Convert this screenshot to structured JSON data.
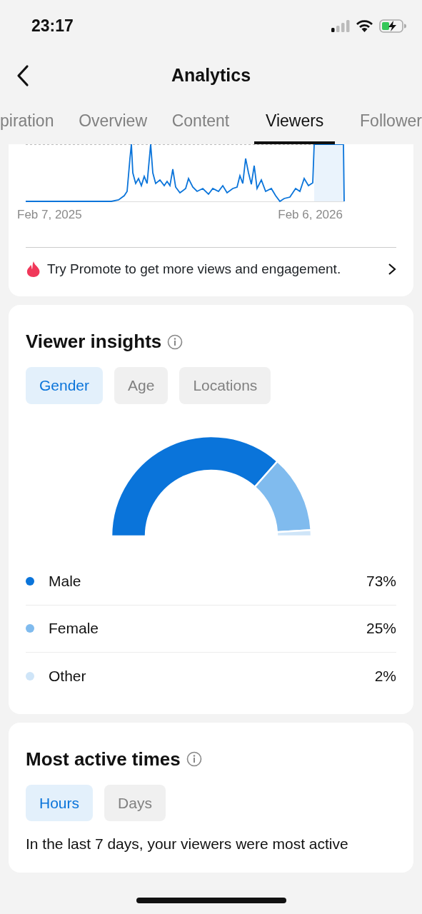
{
  "status_bar": {
    "time": "23:17"
  },
  "header": {
    "title": "Analytics"
  },
  "tabs": [
    {
      "label": "piration",
      "selected": false
    },
    {
      "label": "Overview",
      "selected": false
    },
    {
      "label": "Content",
      "selected": false
    },
    {
      "label": "Viewers",
      "selected": true
    },
    {
      "label": "Follower",
      "selected": false
    }
  ],
  "views_chart": {
    "start_label": "Feb 7, 2025",
    "end_label": "Feb 6, 2026"
  },
  "promote": {
    "text": "Try Promote to get more views and engagement."
  },
  "viewer_insights": {
    "title": "Viewer insights",
    "filters": [
      {
        "label": "Gender",
        "selected": true
      },
      {
        "label": "Age",
        "selected": false
      },
      {
        "label": "Locations",
        "selected": false
      }
    ],
    "chart_data": {
      "type": "donut",
      "categories": [
        "Male",
        "Female",
        "Other"
      ],
      "values": [
        73,
        25,
        2
      ],
      "colors": [
        "#0a74da",
        "#80bbee",
        "#cfe5f8"
      ]
    },
    "legend": [
      {
        "value": "73%"
      },
      {
        "value": "25%"
      },
      {
        "value": "2%"
      }
    ]
  },
  "most_active_times": {
    "title": "Most active times",
    "filters": [
      {
        "label": "Hours",
        "selected": true
      },
      {
        "label": "Days",
        "selected": false
      }
    ],
    "summary": "In the last 7 days, your viewers were most active"
  }
}
